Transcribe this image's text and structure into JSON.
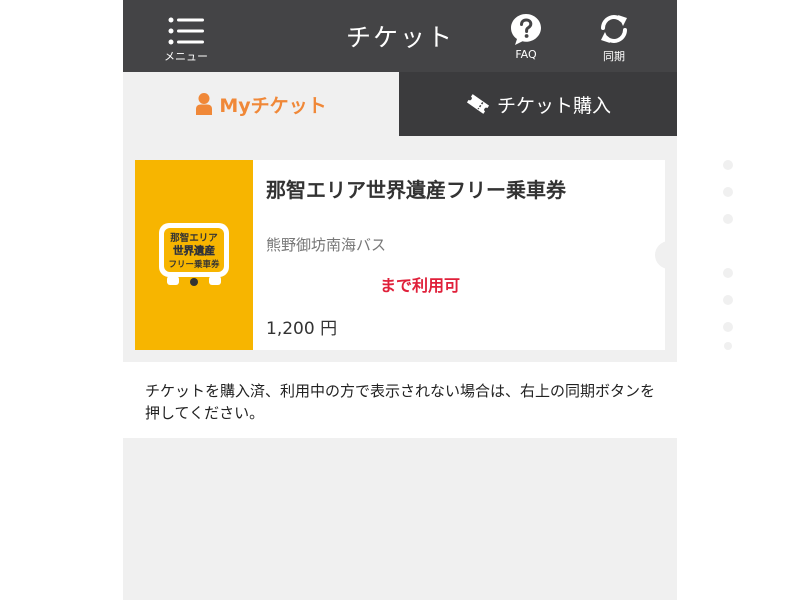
{
  "header": {
    "menu_label": "メニュー",
    "title": "チケット",
    "faq_label": "FAQ",
    "sync_label": "同期",
    "background": "#444446"
  },
  "tabs": [
    {
      "label": "Myチケット",
      "active": true,
      "color": "#f08838"
    },
    {
      "label": "チケット購入",
      "active": false
    }
  ],
  "ticket": {
    "name": "那智エリア世界遺産フリー乗車券",
    "company": "熊野御坊南海バス",
    "validity": "まで利用可",
    "price": "1,200 円",
    "image_text": [
      "那智エリア",
      "世界遺産",
      "フリー乗車券"
    ],
    "image_color": "#f7b500"
  },
  "notice": "チケットを購入済、利用中の方で表示されない場合は、右上の同期ボタンを押してください。",
  "colors": {
    "accent": "#f08838",
    "valid_red": "#e0203a",
    "page_bg": "#f0f0f0"
  }
}
